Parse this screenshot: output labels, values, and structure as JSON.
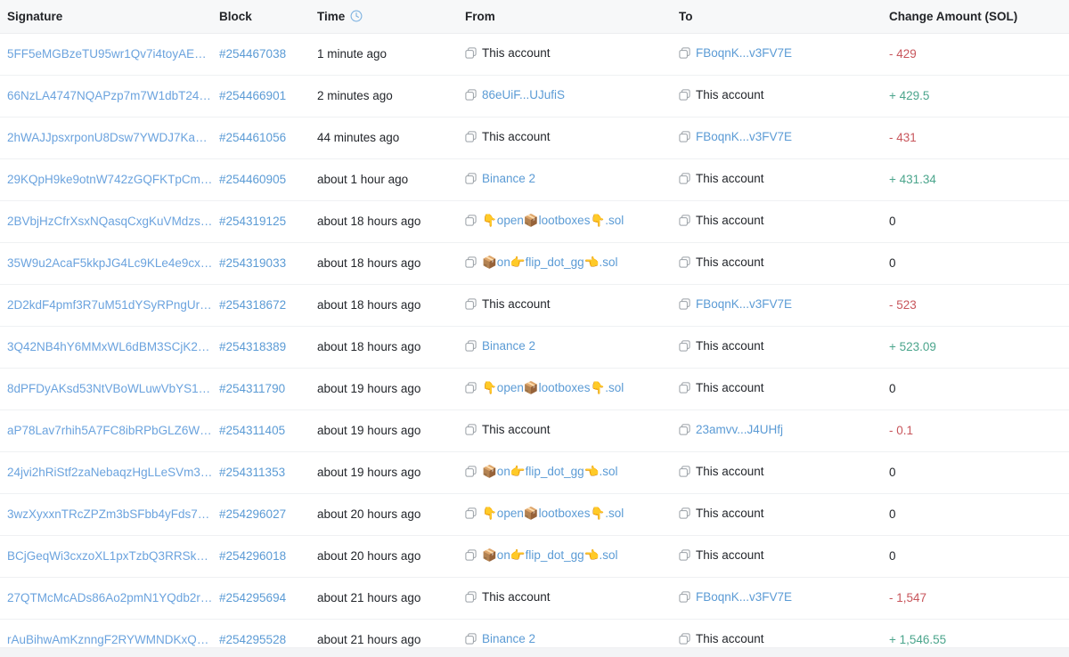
{
  "table": {
    "columns": [
      {
        "key": "signature",
        "label": "Signature",
        "icon": null
      },
      {
        "key": "block",
        "label": "Block",
        "icon": null
      },
      {
        "key": "time",
        "label": "Time",
        "icon": "clock-icon"
      },
      {
        "key": "from",
        "label": "From",
        "icon": null
      },
      {
        "key": "to",
        "label": "To",
        "icon": null
      },
      {
        "key": "amount",
        "label": "Change Amount (SOL)",
        "icon": null
      }
    ],
    "rows": [
      {
        "signature": "5FF5eMGBzeTU95wr1Qv7i4toyAEK…",
        "block": "#254467038",
        "time": "1 minute ago",
        "from": {
          "label": "This account",
          "link": false,
          "copy": true
        },
        "to": {
          "label": "FBoqnK...v3FV7E",
          "link": true,
          "copy": true
        },
        "amount": "- 429",
        "amount_sign": "neg"
      },
      {
        "signature": "66NzLA4747NQAPzp7m7W1dbT24…",
        "block": "#254466901",
        "time": "2 minutes ago",
        "from": {
          "label": "86eUiF...UJufiS",
          "link": true,
          "copy": true
        },
        "to": {
          "label": "This account",
          "link": false,
          "copy": true
        },
        "amount": "+ 429.5",
        "amount_sign": "pos"
      },
      {
        "signature": "2hWAJJpsxrponU8Dsw7YWDJ7Ka…",
        "block": "#254461056",
        "time": "44 minutes ago",
        "from": {
          "label": "This account",
          "link": false,
          "copy": true
        },
        "to": {
          "label": "FBoqnK...v3FV7E",
          "link": true,
          "copy": true
        },
        "amount": "- 431",
        "amount_sign": "neg"
      },
      {
        "signature": "29KQpH9ke9otnW742zGQFKTpCm…",
        "block": "#254460905",
        "time": "about 1 hour ago",
        "from": {
          "label": "Binance 2",
          "link": true,
          "copy": true
        },
        "to": {
          "label": "This account",
          "link": false,
          "copy": true
        },
        "amount": "+ 431.34",
        "amount_sign": "pos"
      },
      {
        "signature": "2BVbjHzCfrXsxNQasqCxgKuVMdzs…",
        "block": "#254319125",
        "time": "about 18 hours ago",
        "from": {
          "label": "👇open📦lootboxes👇.sol",
          "link": true,
          "copy": true
        },
        "to": {
          "label": "This account",
          "link": false,
          "copy": true
        },
        "amount": "0",
        "amount_sign": "zero"
      },
      {
        "signature": "35W9u2AcaF5kkpJG4Lc9KLe4e9cx…",
        "block": "#254319033",
        "time": "about 18 hours ago",
        "from": {
          "label": "📦on👉flip_dot_gg👈.sol",
          "link": true,
          "copy": true
        },
        "to": {
          "label": "This account",
          "link": false,
          "copy": true
        },
        "amount": "0",
        "amount_sign": "zero"
      },
      {
        "signature": "2D2kdF4pmf3R7uM51dYSyRPngUr…",
        "block": "#254318672",
        "time": "about 18 hours ago",
        "from": {
          "label": "This account",
          "link": false,
          "copy": true
        },
        "to": {
          "label": "FBoqnK...v3FV7E",
          "link": true,
          "copy": true
        },
        "amount": "- 523",
        "amount_sign": "neg"
      },
      {
        "signature": "3Q42NB4hY6MMxWL6dBM3SCjK2…",
        "block": "#254318389",
        "time": "about 18 hours ago",
        "from": {
          "label": "Binance 2",
          "link": true,
          "copy": true
        },
        "to": {
          "label": "This account",
          "link": false,
          "copy": true
        },
        "amount": "+ 523.09",
        "amount_sign": "pos"
      },
      {
        "signature": "8dPFDyAKsd53NtVBoWLuwVbYS1…",
        "block": "#254311790",
        "time": "about 19 hours ago",
        "from": {
          "label": "👇open📦lootboxes👇.sol",
          "link": true,
          "copy": true
        },
        "to": {
          "label": "This account",
          "link": false,
          "copy": true
        },
        "amount": "0",
        "amount_sign": "zero"
      },
      {
        "signature": "aP78Lav7rhih5A7FC8ibRPbGLZ6W…",
        "block": "#254311405",
        "time": "about 19 hours ago",
        "from": {
          "label": "This account",
          "link": false,
          "copy": true
        },
        "to": {
          "label": "23amvv...J4UHfj",
          "link": true,
          "copy": true
        },
        "amount": "- 0.1",
        "amount_sign": "neg"
      },
      {
        "signature": "24jvi2hRiStf2zaNebaqzHgLLeSVm3…",
        "block": "#254311353",
        "time": "about 19 hours ago",
        "from": {
          "label": "📦on👉flip_dot_gg👈.sol",
          "link": true,
          "copy": true
        },
        "to": {
          "label": "This account",
          "link": false,
          "copy": true
        },
        "amount": "0",
        "amount_sign": "zero"
      },
      {
        "signature": "3wzXyxxnTRcZPZm3bSFbb4yFds7…",
        "block": "#254296027",
        "time": "about 20 hours ago",
        "from": {
          "label": "👇open📦lootboxes👇.sol",
          "link": true,
          "copy": true
        },
        "to": {
          "label": "This account",
          "link": false,
          "copy": true
        },
        "amount": "0",
        "amount_sign": "zero"
      },
      {
        "signature": "BCjGeqWi3cxzoXL1pxTzbQ3RRSk3…",
        "block": "#254296018",
        "time": "about 20 hours ago",
        "from": {
          "label": "📦on👉flip_dot_gg👈.sol",
          "link": true,
          "copy": true
        },
        "to": {
          "label": "This account",
          "link": false,
          "copy": true
        },
        "amount": "0",
        "amount_sign": "zero"
      },
      {
        "signature": "27QTMcMcADs86Ao2pmN1YQdb2r…",
        "block": "#254295694",
        "time": "about 21 hours ago",
        "from": {
          "label": "This account",
          "link": false,
          "copy": true
        },
        "to": {
          "label": "FBoqnK...v3FV7E",
          "link": true,
          "copy": true
        },
        "amount": "- 1,547",
        "amount_sign": "neg"
      },
      {
        "signature": "rAuBihwAmKznngF2RYWMNDKxQ2…",
        "block": "#254295528",
        "time": "about 21 hours ago",
        "from": {
          "label": "Binance 2",
          "link": true,
          "copy": true
        },
        "to": {
          "label": "This account",
          "link": false,
          "copy": true
        },
        "amount": "+ 1,546.55",
        "amount_sign": "pos"
      }
    ]
  },
  "colors": {
    "link": "#5b9bd5",
    "positive": "#4ba58c",
    "negative": "#c8565c",
    "header_bg": "#f7f8f9",
    "row_border": "#eff1f3",
    "text": "#23262b"
  }
}
